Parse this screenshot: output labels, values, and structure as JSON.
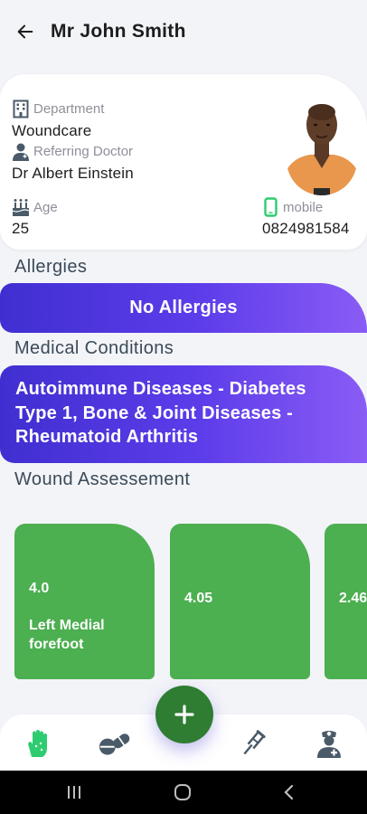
{
  "header": {
    "title": "Mr John Smith"
  },
  "profile": {
    "department_label": "Department",
    "department_value": "Woundcare",
    "doctor_label": "Referring Doctor",
    "doctor_value": "Dr Albert Einstein",
    "age_label": "Age",
    "age_value": "25",
    "mobile_label": "mobile",
    "mobile_value": "0824981584"
  },
  "allergies": {
    "heading": "Allergies",
    "value": "No Allergies"
  },
  "conditions": {
    "heading": "Medical Conditions",
    "value": "Autoimmune Diseases - Diabetes Type 1, Bone & Joint Diseases - Rheumatoid Arthritis"
  },
  "wounds": {
    "heading": "Wound Assessement",
    "items": [
      {
        "value": "4.0",
        "location": "Left Medial forefoot"
      },
      {
        "value": "4.05"
      },
      {
        "value": "2.46"
      }
    ]
  },
  "colors": {
    "accent_gradient_start": "#3f2fd0",
    "accent_gradient_end": "#8a5cf5",
    "wound_card_green": "#4caf50",
    "fab_green": "#2e7d32",
    "icon_green": "#2ecc71"
  },
  "icons": {
    "back": "arrow-left-icon",
    "department": "building-icon",
    "doctor": "doctor-icon",
    "age": "birthday-cake-icon",
    "mobile": "mobile-phone-icon",
    "fab": "plus-icon",
    "nav": [
      "hand-icon",
      "pills-icon",
      "crutch-icon",
      "nurse-icon"
    ]
  }
}
